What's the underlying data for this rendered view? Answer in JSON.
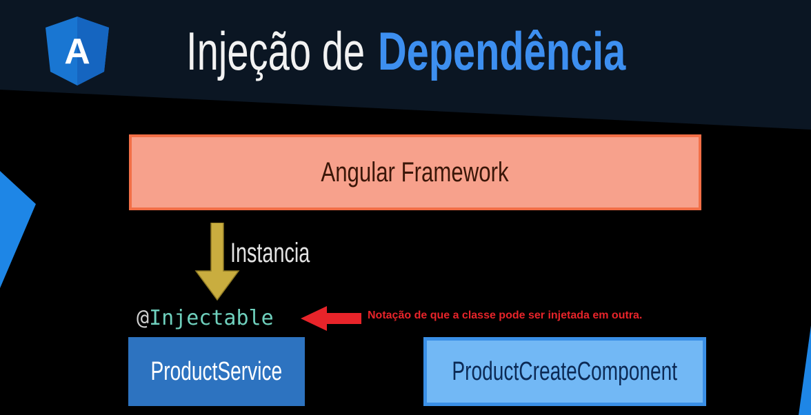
{
  "title": {
    "light": "Injeção de",
    "bold": "Dependência"
  },
  "logo": {
    "letter": "A",
    "icon": "angular-shield-icon"
  },
  "diagram": {
    "framework_label": "Angular Framework",
    "arrow_label": "Instancia",
    "decorator_at": "@",
    "decorator_name": "Injectable",
    "note": "Notação de que a classe pode ser injetada em outra.",
    "service_label": "ProductService",
    "component_label": "ProductCreateComponent"
  },
  "colors": {
    "title_accent": "#3d8ff0",
    "framework_fill": "#f7a18c",
    "framework_border": "#f26f47",
    "arrow_gold": "#c9ad3f",
    "note_red": "#e8242a",
    "service_fill": "#2d73c0",
    "component_fill": "#72b8f5",
    "component_border": "#3a8fe6"
  }
}
